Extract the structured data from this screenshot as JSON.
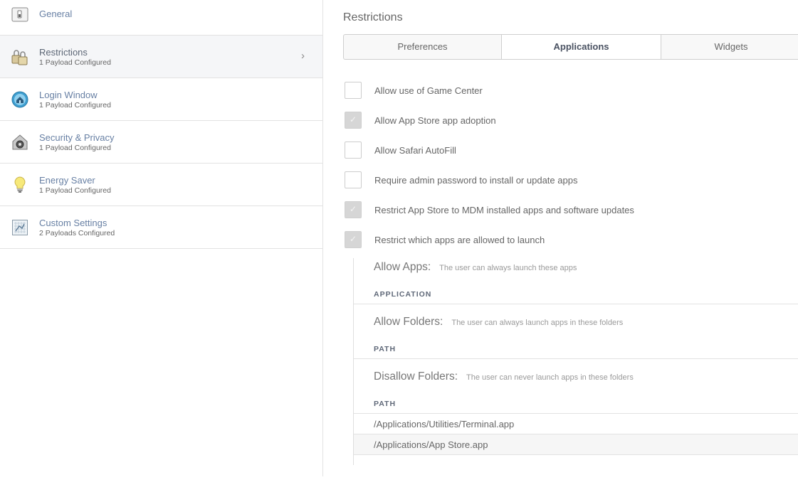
{
  "sidebar": {
    "items": [
      {
        "title": "General",
        "subtitle": "",
        "icon": "switch-icon"
      },
      {
        "title": "Restrictions",
        "subtitle": "1 Payload Configured",
        "icon": "restrictions-icon"
      },
      {
        "title": "Login Window",
        "subtitle": "1 Payload Configured",
        "icon": "login-window-icon"
      },
      {
        "title": "Security & Privacy",
        "subtitle": "1 Payload Configured",
        "icon": "security-house-icon"
      },
      {
        "title": "Energy Saver",
        "subtitle": "1 Payload Configured",
        "icon": "lightbulb-icon"
      },
      {
        "title": "Custom Settings",
        "subtitle": "2 Payloads Configured",
        "icon": "custom-settings-icon"
      }
    ],
    "chevron": "›"
  },
  "main": {
    "title": "Restrictions",
    "tabs": [
      {
        "label": "Preferences",
        "active": false
      },
      {
        "label": "Applications",
        "active": true
      },
      {
        "label": "Widgets",
        "active": false
      }
    ],
    "options": [
      {
        "label": "Allow use of Game Center",
        "checked": false
      },
      {
        "label": "Allow App Store app adoption",
        "checked": true
      },
      {
        "label": "Allow Safari AutoFill",
        "checked": false
      },
      {
        "label": "Require admin password to install or update apps",
        "checked": false
      },
      {
        "label": "Restrict App Store to MDM installed apps and software updates",
        "checked": true
      },
      {
        "label": "Restrict which apps are allowed to launch",
        "checked": true
      }
    ],
    "allow_apps": {
      "title": "Allow Apps:",
      "desc": "The user can always launch these apps",
      "column": "APPLICATION"
    },
    "allow_folders": {
      "title": "Allow Folders:",
      "desc": "The user can always launch apps in these folders",
      "column": "PATH"
    },
    "disallow_folders": {
      "title": "Disallow Folders:",
      "desc": "The user can never launch apps in these folders",
      "column": "PATH",
      "paths": [
        "/Applications/Utilities/Terminal.app",
        "/Applications/App Store.app"
      ]
    }
  },
  "colors": {
    "link_blue": "#6880a4",
    "selected_bg": "#f5f6f8",
    "checked_box": "#d6d6d6"
  }
}
